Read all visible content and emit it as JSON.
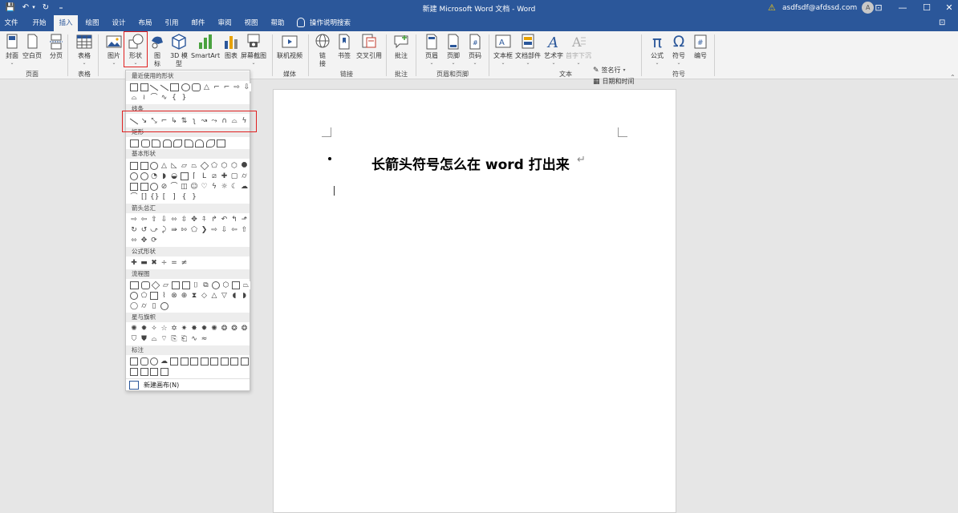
{
  "window": {
    "title": "新建 Microsoft Word 文档 - Word",
    "account": "asdfsdf@afdssd.com",
    "avatar_letter": "A"
  },
  "quick_access": {
    "save": "💾",
    "undo": "↶",
    "undo_dd": "▾",
    "redo": "↻",
    "customize": "₌"
  },
  "window_controls": {
    "ribbon_options": "⊡",
    "minimize": "—",
    "maximize": "☐",
    "close": "✕"
  },
  "tabs": [
    "文件",
    "开始",
    "插入",
    "绘图",
    "设计",
    "布局",
    "引用",
    "邮件",
    "审阅",
    "视图",
    "帮助"
  ],
  "active_tab": "插入",
  "tell_me": "操作说明搜索",
  "share_icon": "⊡",
  "ribbon": {
    "buttons": {
      "cover": "封面",
      "blank_page": "空白页",
      "page_break": "分页",
      "table": "表格",
      "picture": "图片",
      "shapes": "形状",
      "icons_1": "图",
      "icons_2": "标",
      "model3d_1": "3D 模",
      "model3d_2": "型",
      "smartart": "SmartArt",
      "chart": "图表",
      "screenshot": "屏幕截图",
      "online_video": "联机视频",
      "link_1": "链",
      "link_2": "接",
      "bookmark": "书签",
      "cross_ref": "交叉引用",
      "comment": "批注",
      "header": "页眉",
      "footer": "页脚",
      "page_number": "页码",
      "textbox": "文本框",
      "quick_parts": "文档部件",
      "wordart": "艺术字",
      "dropcap": "首字下沉",
      "signature": "签名行",
      "datetime": "日期和时间",
      "object": "对象",
      "equation": "公式",
      "symbol": "符号",
      "numbering": "编号"
    },
    "groups": {
      "pages": "页面",
      "tables": "表格",
      "media": "媒体",
      "links": "链接",
      "comments": "批注",
      "header_footer": "页眉和页脚",
      "text": "文本",
      "symbols": "符号"
    },
    "symbol_glyphs": {
      "pi": "π",
      "omega": "Ω",
      "hash": "#"
    }
  },
  "shapes_menu": {
    "sections": {
      "recent": "最近使用的形状",
      "lines": "线条",
      "rectangles": "矩形",
      "basic": "基本形状",
      "arrows": "箭头总汇",
      "equation": "公式形状",
      "flowchart": "流程图",
      "stars": "星与旗帜",
      "callouts": "标注"
    },
    "new_canvas": "新建画布(N)"
  },
  "document": {
    "heading": "长箭头符号怎么在 word 打出来",
    "paragraph_mark": "↵",
    "empty_mark": "↵"
  },
  "colors": {
    "accent": "#2b579a",
    "highlight": "#e02020"
  }
}
